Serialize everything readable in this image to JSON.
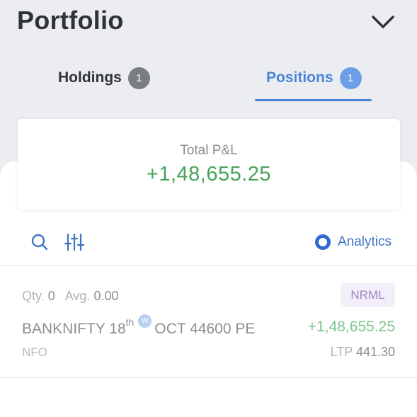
{
  "header": {
    "title": "Portfolio"
  },
  "tabs": [
    {
      "label": "Holdings",
      "count": "1",
      "active": false
    },
    {
      "label": "Positions",
      "count": "1",
      "active": true
    }
  ],
  "summary": {
    "label": "Total P&L",
    "value": "+1,48,655.25"
  },
  "toolbar": {
    "analytics_label": "Analytics"
  },
  "positions": [
    {
      "qty_label": "Qty.",
      "qty": "0",
      "avg_label": "Avg.",
      "avg": "0.00",
      "product": "NRML",
      "symbol_prefix": "BANKNIFTY 18",
      "symbol_ordinal": "th",
      "weekly_badge": "W",
      "symbol_suffix": "OCT 44600 PE",
      "pnl": "+1,48,655.25",
      "exchange": "NFO",
      "ltp_label": "LTP",
      "ltp": "441.30"
    }
  ],
  "colors": {
    "accent": "#4a86d9",
    "profit": "#45a35a",
    "background": "#ecedf0"
  },
  "icons": [
    "chevron-down-icon",
    "search-icon",
    "filter-sliders-icon",
    "analytics-ring-icon"
  ]
}
